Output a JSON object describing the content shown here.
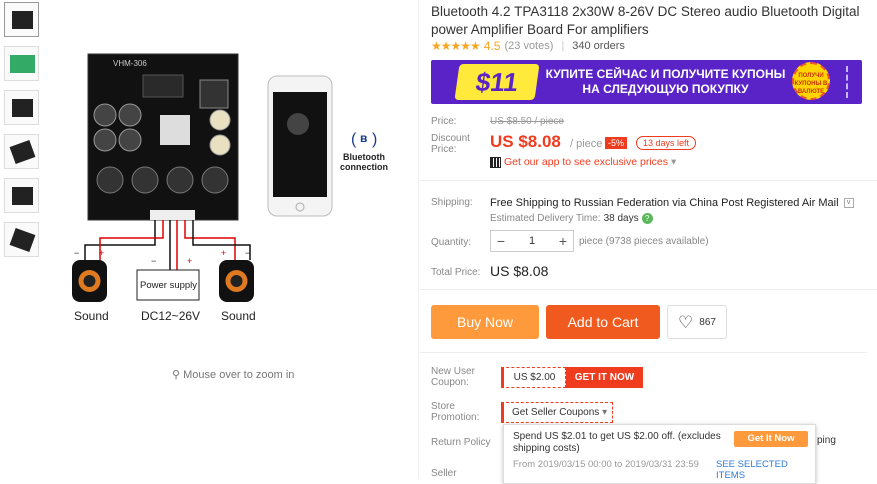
{
  "product": {
    "title": "Bluetooth 4.2 TPA3118 2x30W 8-26V DC Stereo audio Bluetooth Digital power Amplifier Board For amplifiers",
    "stars": "★★★★★",
    "rating": "4.5",
    "votes": "(23 votes)",
    "orders": "340 orders"
  },
  "gallery": {
    "board_label": "VHM-306",
    "bluetooth_label_1": "Bluetooth",
    "bluetooth_label_2": "connection",
    "power_supply": "Power supply",
    "voltage": "DC12~26V",
    "sound_left": "Sound",
    "sound_right": "Sound",
    "zoom_hint": "Mouse over to zoom in",
    "minus": "−",
    "plus": "+"
  },
  "banner": {
    "amount": "$11",
    "text": "КУПИТЕ СЕЙЧАС И ПОЛУЧИТЕ КУПОНЫ НА СЛЕДУЮЩУЮ ПОКУПКУ",
    "badge": "ПОЛУЧИ КУПОНЫ В ВАЛЮТЕ"
  },
  "pricing": {
    "price_label": "Price:",
    "old_price": "US $8.50 / piece",
    "discount_label": "Discount Price:",
    "price": "US $8.08",
    "per_piece": "/ piece",
    "discount": "-5%",
    "days_left": "13 days left",
    "app_text": "Get our app to see exclusive prices",
    "app_caret": "▾"
  },
  "shipping": {
    "label": "Shipping:",
    "text": "Free Shipping to Russian Federation via China Post Registered Air Mail",
    "dropdown": "v",
    "eta_label": "Estimated Delivery Time:",
    "eta_value": "38 days",
    "help": "?"
  },
  "quantity": {
    "label": "Quantity:",
    "minus": "−",
    "value": "1",
    "plus": "+",
    "available": "piece (9738 pieces available)"
  },
  "total": {
    "label": "Total Price:",
    "value": "US $8.08"
  },
  "actions": {
    "buy_now": "Buy Now",
    "add_to_cart": "Add to Cart",
    "wish_icon": "♡",
    "wish_count": "867"
  },
  "coupons": {
    "new_user_label": "New User Coupon:",
    "new_user_value": "US $2.00",
    "get_it_now": "GET IT NOW",
    "store_label": "Store Promotion:",
    "seller_coupons": "Get Seller Coupons",
    "seller_caret": "▾",
    "popup_text": "Spend US $2.01 to get US $2.00 off. (excludes shipping costs)",
    "popup_dates": "From 2019/03/15 00:00 to 2019/03/31 23:59",
    "popup_see": "SEE SELECTED ITEMS",
    "popup_button": "Get It Now",
    "return_label": "Return Policy",
    "return_tail": "ping",
    "seller_label": "Seller"
  },
  "colors": {
    "accent": "#f03c1e",
    "buy": "#ff9a3c",
    "cart": "#f05a1e",
    "banner": "#5a23c8",
    "stars": "#f5a623"
  }
}
